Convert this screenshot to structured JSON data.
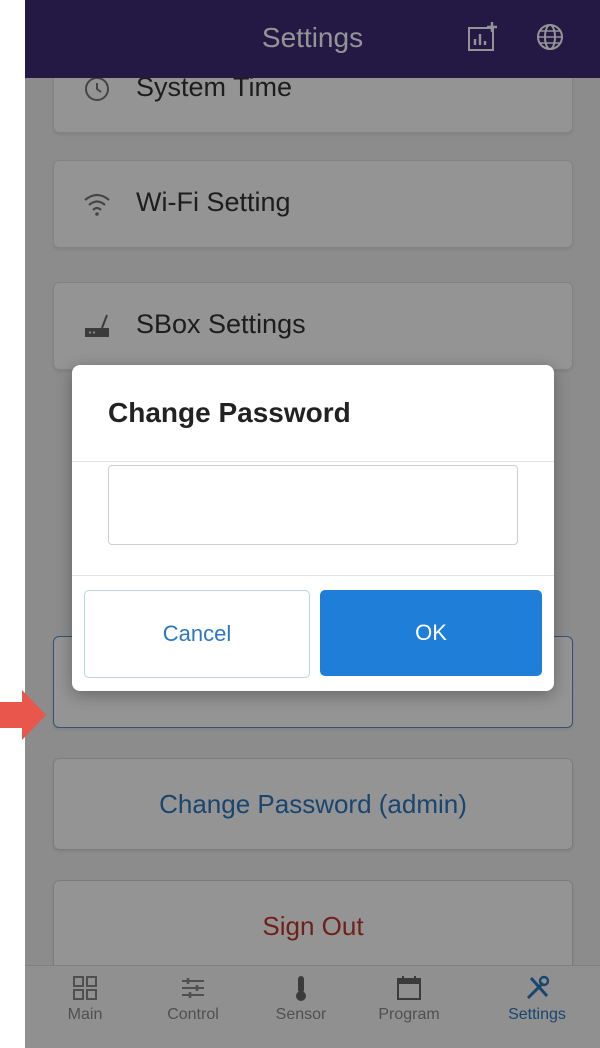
{
  "header": {
    "title": "Settings",
    "icons": [
      "chart-add-icon",
      "globe-icon"
    ]
  },
  "cards": [
    {
      "label": "System Time",
      "icon": "clock-icon"
    },
    {
      "label": "Wi-Fi Setting",
      "icon": "wifi-icon"
    },
    {
      "label": "SBox Settings",
      "icon": "router-icon"
    }
  ],
  "buttons": {
    "change_password_admin": "Change Password (admin)",
    "sign_out": "Sign Out"
  },
  "dialog": {
    "title": "Change Password",
    "input_value": "",
    "cancel_label": "Cancel",
    "ok_label": "OK"
  },
  "tabs": [
    {
      "label": "Main",
      "icon": "grid-icon"
    },
    {
      "label": "Control",
      "icon": "sliders-icon"
    },
    {
      "label": "Sensor",
      "icon": "thermometer-icon"
    },
    {
      "label": "Program",
      "icon": "calendar-icon"
    },
    {
      "label": "Settings",
      "icon": "tools-icon",
      "active": true
    }
  ],
  "colors": {
    "header": "#3e2a78",
    "accent": "#1f7fd8",
    "link": "#2b78c0",
    "danger": "#c0392b",
    "active_tab": "#2b78c0",
    "arrow": "#e8564c"
  }
}
